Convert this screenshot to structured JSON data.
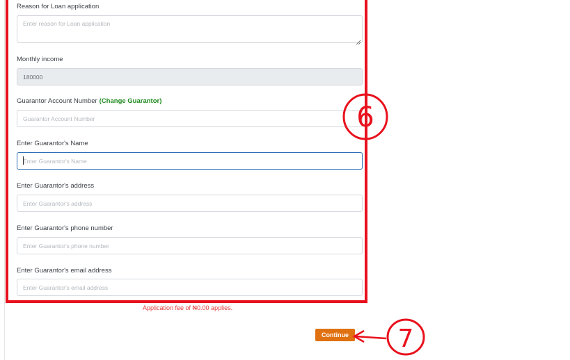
{
  "form": {
    "reason": {
      "label": "Reason for Loan application",
      "placeholder": "Enter reason for Loan application"
    },
    "monthly_income": {
      "label": "Monthly income",
      "value": "180000"
    },
    "guarantor_account": {
      "label": "Guarantor Account Number",
      "change_link": "(Change Guarantor)",
      "placeholder": "Guarantor Account Number"
    },
    "guarantor_name": {
      "label": "Enter Guarantor's Name",
      "placeholder": "Enter Guarantor's Name"
    },
    "guarantor_address": {
      "label": "Enter Guarantor's address",
      "placeholder": "Enter Guarantor's address"
    },
    "guarantor_phone": {
      "label": "Enter Guarantor's phone number",
      "placeholder": "Enter Guarantor's phone number"
    },
    "guarantor_email": {
      "label": "Enter Guarantor's email address",
      "placeholder": "Enter Guarantor's email address"
    }
  },
  "fee_note": "Application fee of ₦0.00 applies.",
  "continue_label": "Continue",
  "annotations": {
    "step_six": "6",
    "step_seven": "7",
    "color": "#e8111d"
  },
  "colors": {
    "button": "#e07111",
    "link": "#1f8a1f",
    "fee_text": "#e23c3c",
    "focus_border": "#2a6fb5"
  }
}
